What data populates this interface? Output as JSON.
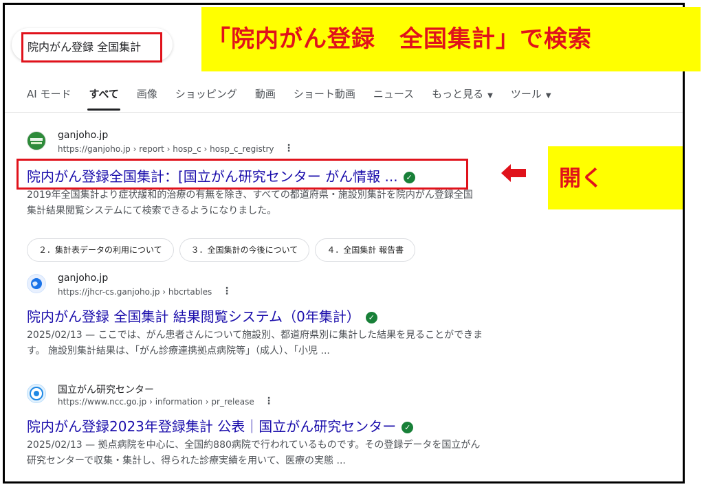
{
  "search": {
    "query": "院内がん登録 全国集計"
  },
  "annotations": {
    "search_callout": "「院内がん登録　全国集計」で検索",
    "open_callout": "開く",
    "highlight_color": "#e0121b",
    "callout_bg": "#ffff00"
  },
  "tabs": [
    {
      "label": "AI モード",
      "active": false
    },
    {
      "label": "すべて",
      "active": true
    },
    {
      "label": "画像",
      "active": false
    },
    {
      "label": "ショッピング",
      "active": false
    },
    {
      "label": "動画",
      "active": false
    },
    {
      "label": "ショート動画",
      "active": false
    },
    {
      "label": "ニュース",
      "active": false
    },
    {
      "label": "もっと見る",
      "active": false,
      "dropdown": true
    },
    {
      "label": "ツール",
      "active": false,
      "dropdown": true
    }
  ],
  "results": [
    {
      "site_name": "ganjoho.jp",
      "url": "https://ganjoho.jp › report › hosp_c › hosp_c_registry",
      "title": "院内がん登録全国集計：[国立がん研究センター がん情報 ...",
      "verified": true,
      "snippet_line1": "2019年全国集計より症状緩和的治療の有無を除き、すべての都道府県・施設別集計を院内がん登録全国",
      "snippet_line2": "集計結果閲覧システムにて検索できるようになりました。",
      "sitelinks": [
        "２．集計表データの利用について",
        "３．全国集計の今後について",
        "４．全国集計 報告書"
      ],
      "favicon": "ganjoho-logo-icon"
    },
    {
      "site_name": "ganjoho.jp",
      "url": "https://jhcr-cs.ganjoho.jp › hbcrtables",
      "title": "院内がん登録 全国集計 結果閲覧システム（0年集計）",
      "verified": true,
      "snippet_line1": "2025/02/13 — ここでは、がん患者さんについて施設別、都道府県別に集計した結果を見ることができま",
      "snippet_line2": "す。 施設別集計結果は、「がん診療連携拠点病院等」（成人）、「小児 ...",
      "favicon": "globe-icon"
    },
    {
      "site_name": "国立がん研究センター",
      "url": "https://www.ncc.go.jp › information › pr_release",
      "title": "院内がん登録2023年登録集計 公表｜国立がん研究センター",
      "verified": true,
      "snippet_line1": "2025/02/13 — 拠点病院を中心に、全国約880病院で行われているものです。その登録データを国立がん",
      "snippet_line2": "研究センターで収集・集計し、得られた診療実績を用いて、医療の実態 ...",
      "favicon": "ncc-logo-icon"
    }
  ],
  "colors": {
    "link": "#1a0dab",
    "verified": "#188038"
  }
}
